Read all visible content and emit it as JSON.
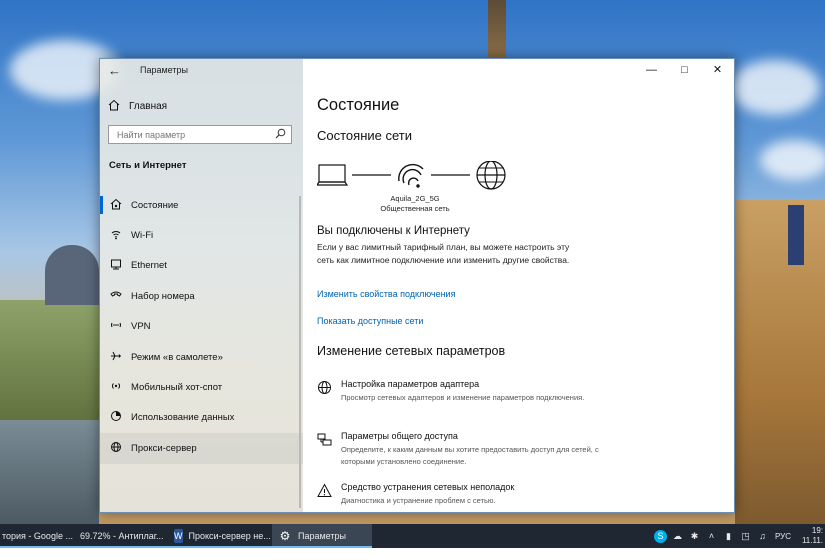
{
  "window": {
    "app_title": "Параметры",
    "home_label": "Главная",
    "search_placeholder": "Найти параметр",
    "section_title": "Сеть и Интернет"
  },
  "sidebar": {
    "items": [
      {
        "label": "Состояние",
        "icon": "home-status-icon"
      },
      {
        "label": "Wi-Fi",
        "icon": "wifi-icon"
      },
      {
        "label": "Ethernet",
        "icon": "ethernet-icon"
      },
      {
        "label": "Набор номера",
        "icon": "phone-icon"
      },
      {
        "label": "VPN",
        "icon": "vpn-icon"
      },
      {
        "label": "Режим «в самолете»",
        "icon": "airplane-icon"
      },
      {
        "label": "Мобильный хот-спот",
        "icon": "hotspot-icon"
      },
      {
        "label": "Использование данных",
        "icon": "data-usage-icon"
      },
      {
        "label": "Прокси-сервер",
        "icon": "globe-icon"
      }
    ]
  },
  "main": {
    "title": "Состояние",
    "network_status_title": "Состояние сети",
    "network_name": "Aquila_2G_5G",
    "network_type": "Общественная сеть",
    "connected_title": "Вы подключены к Интернету",
    "connected_desc": "Если у вас лимитный тарифный план, вы можете настроить эту сеть как лимитное подключение или изменить другие свойства.",
    "link_change_props": "Изменить свойства подключения",
    "link_show_networks": "Показать доступные сети",
    "change_settings_title": "Изменение сетевых параметров",
    "options": [
      {
        "title": "Настройка параметров адаптера",
        "desc": "Просмотр сетевых адаптеров и изменение параметров подключения."
      },
      {
        "title": "Параметры общего доступа",
        "desc": "Определите, к каким данным вы хотите предоставить доступ для сетей, с которыми установлено соединение."
      },
      {
        "title": "Средство устранения сетевых неполадок",
        "desc": "Диагностика и устранение проблем с сетью."
      }
    ]
  },
  "taskbar": {
    "items": [
      {
        "label": "тория - Google ..."
      },
      {
        "label": "69.72% - Антиплаг..."
      },
      {
        "label": "Прокси-сервер не..."
      },
      {
        "label": "Параметры"
      }
    ],
    "lang": "РУС",
    "time": "19:",
    "date": "11.11."
  },
  "colors": {
    "accent": "#0066cc",
    "link": "#0063b1",
    "taskbar": "#1e2732"
  }
}
